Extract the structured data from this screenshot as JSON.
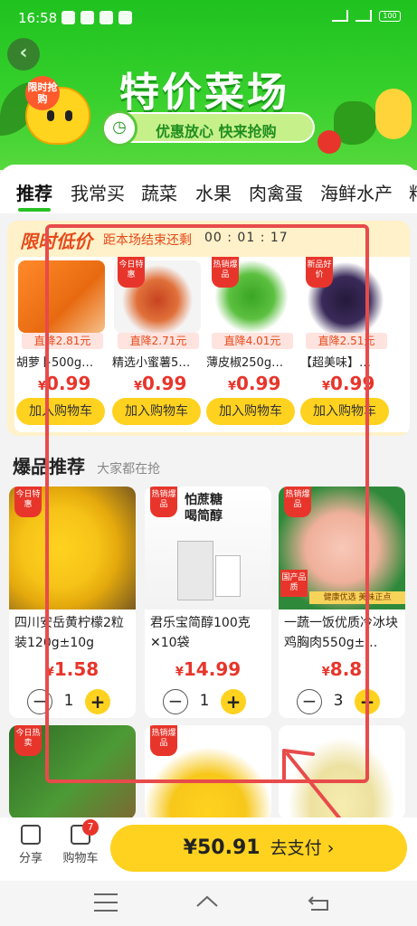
{
  "status": {
    "time": "16:58",
    "battery": "100"
  },
  "header": {
    "title": "特价菜场",
    "subtitle": "优惠放心 快来抢购",
    "mascot_badge": "限时抢购"
  },
  "tabs": [
    "推荐",
    "我常买",
    "蔬菜",
    "水果",
    "肉禽蛋",
    "海鲜水产",
    "料"
  ],
  "flash": {
    "title": "限时低价",
    "countdown_label": "距本场结束还剩",
    "timer": "00 : 01 : 17",
    "items": [
      {
        "ribbon": "",
        "discount": "直降2.81元",
        "name": "胡萝卜500g…",
        "price": "0.99",
        "cart": "加入购物车"
      },
      {
        "ribbon": "今日特惠",
        "discount": "直降2.71元",
        "name": "精选小蜜薯5…",
        "price": "0.99",
        "cart": "加入购物车"
      },
      {
        "ribbon": "热销爆品",
        "discount": "直降4.01元",
        "name": "薄皮椒250g…",
        "price": "0.99",
        "cart": "加入购物车"
      },
      {
        "ribbon": "新品好价",
        "discount": "直降2.51元",
        "name": "【超美味】…",
        "price": "0.99",
        "cart": "加入购物车"
      }
    ]
  },
  "hot": {
    "title": "爆品推荐",
    "subtitle": "大家都在抢",
    "items": [
      {
        "ribbon": "今日特惠",
        "name": "四川安岳黄柠檬2粒装120g±10g",
        "price": "1.58",
        "qty": "1"
      },
      {
        "ribbon": "热销爆品",
        "name": "君乐宝简醇100克✕10袋",
        "price": "14.99",
        "qty": "1",
        "banner": "怕蔗糖 喝简醇"
      },
      {
        "ribbon": "热销爆品",
        "name": "一蔬一饭优质冷冰块鸡胸肉550g±…",
        "price": "8.8",
        "qty": "3",
        "tag1": "国产品质",
        "tag2": "健康优选 美味正点"
      },
      {
        "ribbon": "今日热卖",
        "name": "",
        "price": "",
        "qty": ""
      },
      {
        "ribbon": "热销爆品",
        "name": "",
        "price": "",
        "qty": ""
      },
      {
        "ribbon": "",
        "name": "",
        "price": "",
        "qty": ""
      }
    ]
  },
  "bottom": {
    "share": "分享",
    "cart": "购物车",
    "cart_count": "7",
    "pay_amount": "¥50.91",
    "pay_label": "去支付 ›"
  },
  "currency": "¥",
  "colors": {
    "brand_green": "#28c124",
    "accent_yellow": "#ffd21f",
    "price_red": "#e8352b",
    "annotation_red": "#e84b4b"
  }
}
